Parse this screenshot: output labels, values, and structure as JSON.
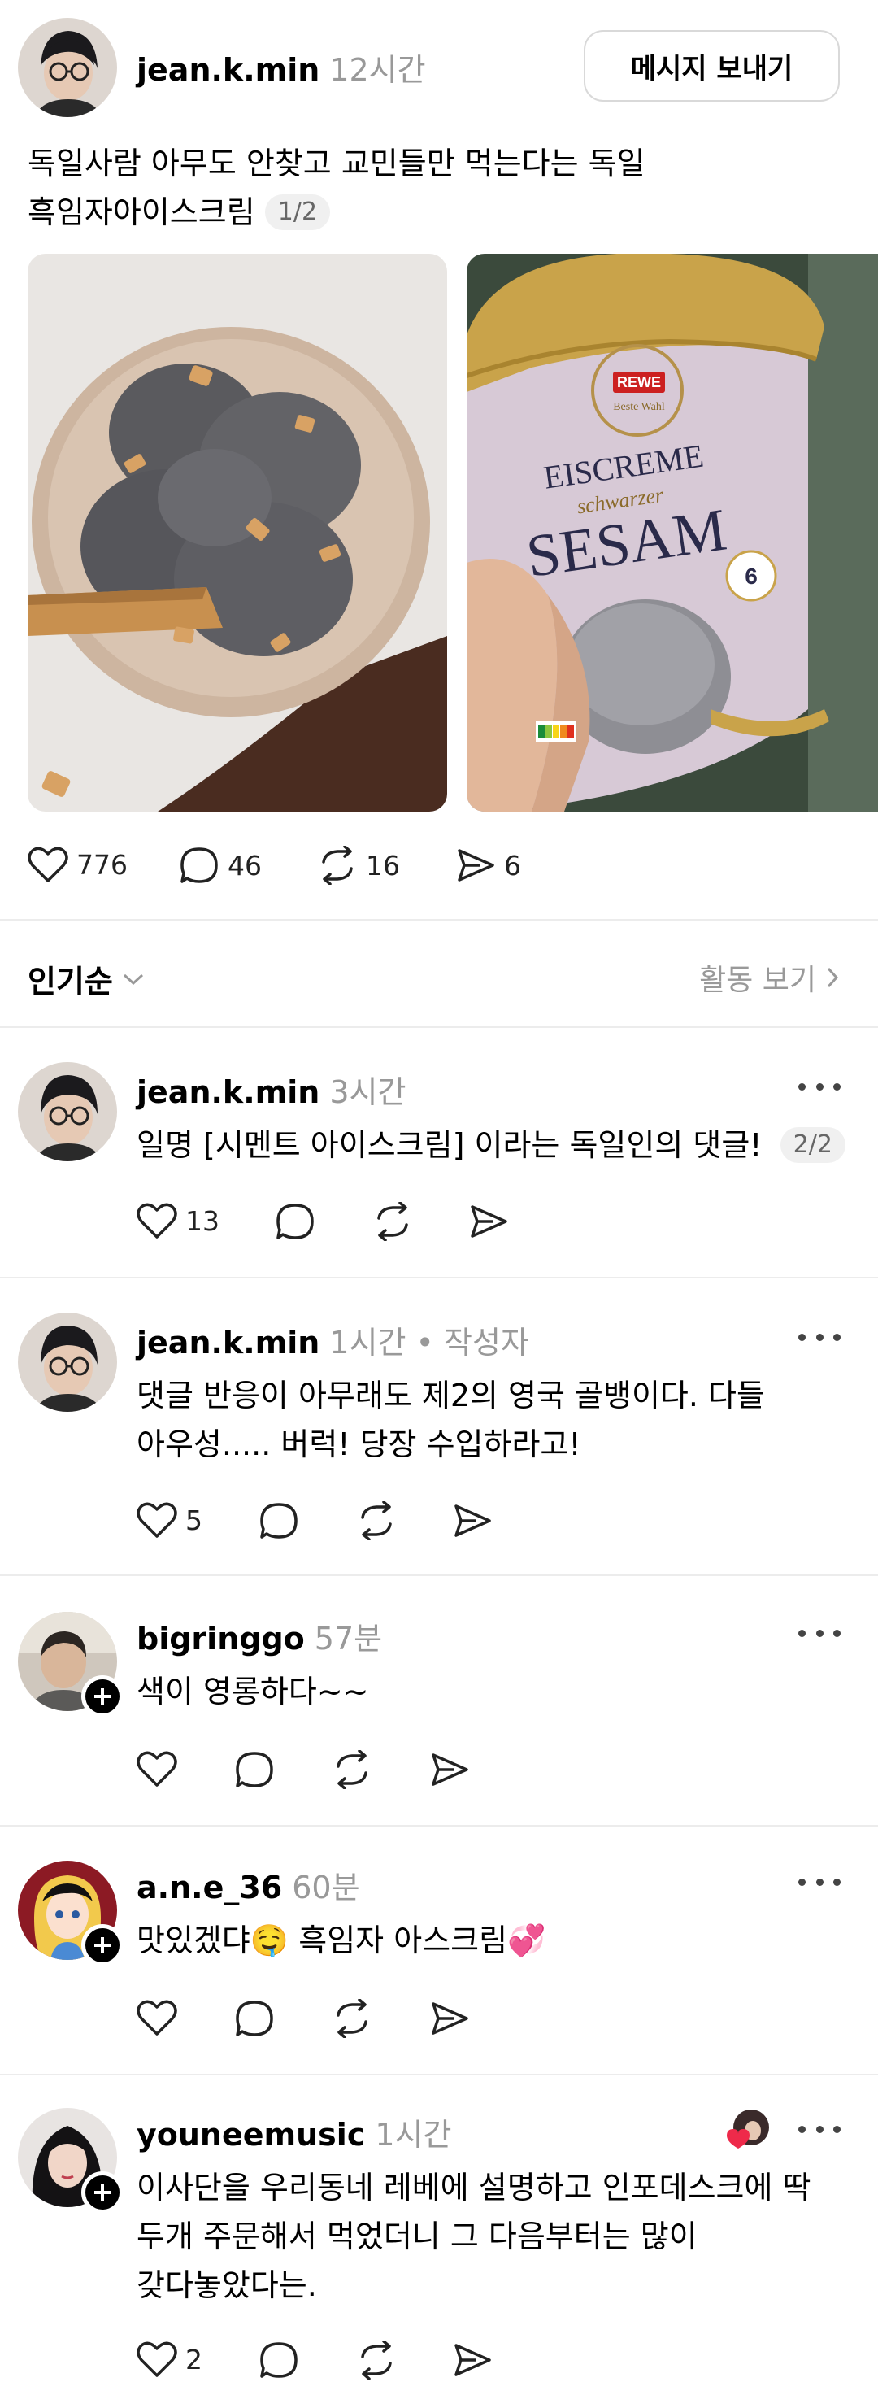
{
  "post": {
    "username": "jean.k.min",
    "time": "12시간",
    "message_button": "메시지 보내기",
    "text_line1": "독일사람 아무도 안찾고 교민들만 먹는다는 독일",
    "text_line2": "흑임자아이스크림",
    "page_indicator": "1/2",
    "image_labels": {
      "brand": "REWE",
      "brand_sub": "Beste Wahl",
      "title": "EISCREME",
      "subtitle": "schwarzer",
      "product": "SESAM",
      "badge": "6"
    },
    "actions": {
      "likes": "776",
      "comments": "46",
      "reposts": "16",
      "shares": "6"
    }
  },
  "sort": {
    "label": "인기순",
    "activity": "활동 보기"
  },
  "comments": [
    {
      "username": "jean.k.min",
      "time": "3시간",
      "tag": "",
      "line1": "일명 [시멘트 아이스크림] 이라는 독일인의 댓글!",
      "line2": "",
      "line3": "",
      "badge": "2/2",
      "likes": "13"
    },
    {
      "username": "jean.k.min",
      "time": "1시간",
      "tag": " • 작성자",
      "line1": "댓글 반응이 아무래도 제2의 영국 골뱅이다. 다들",
      "line2": "아우성..... 버럭! 당장 수입하라고!",
      "line3": "",
      "badge": "",
      "likes": "5"
    },
    {
      "username": "bigringgo",
      "time": "57분",
      "tag": "",
      "line1": "색이 영롱하다~~",
      "line2": "",
      "line3": "",
      "badge": "",
      "likes": ""
    },
    {
      "username": "a.n.e_36",
      "time": "60분",
      "tag": "",
      "line1": "맛있겠댜🤤  흑임자 아스크림💞",
      "line2": "",
      "line3": "",
      "badge": "",
      "likes": ""
    },
    {
      "username": "youneemusic",
      "time": "1시간",
      "tag": "",
      "line1": "이사단을 우리동네 레베에 설명하고 인포데스크에 딱",
      "line2": "두개 주문해서 먹었더니 그 다음부터는 많이",
      "line3": "갖다놓았다는.",
      "badge": "",
      "likes": "2"
    }
  ]
}
